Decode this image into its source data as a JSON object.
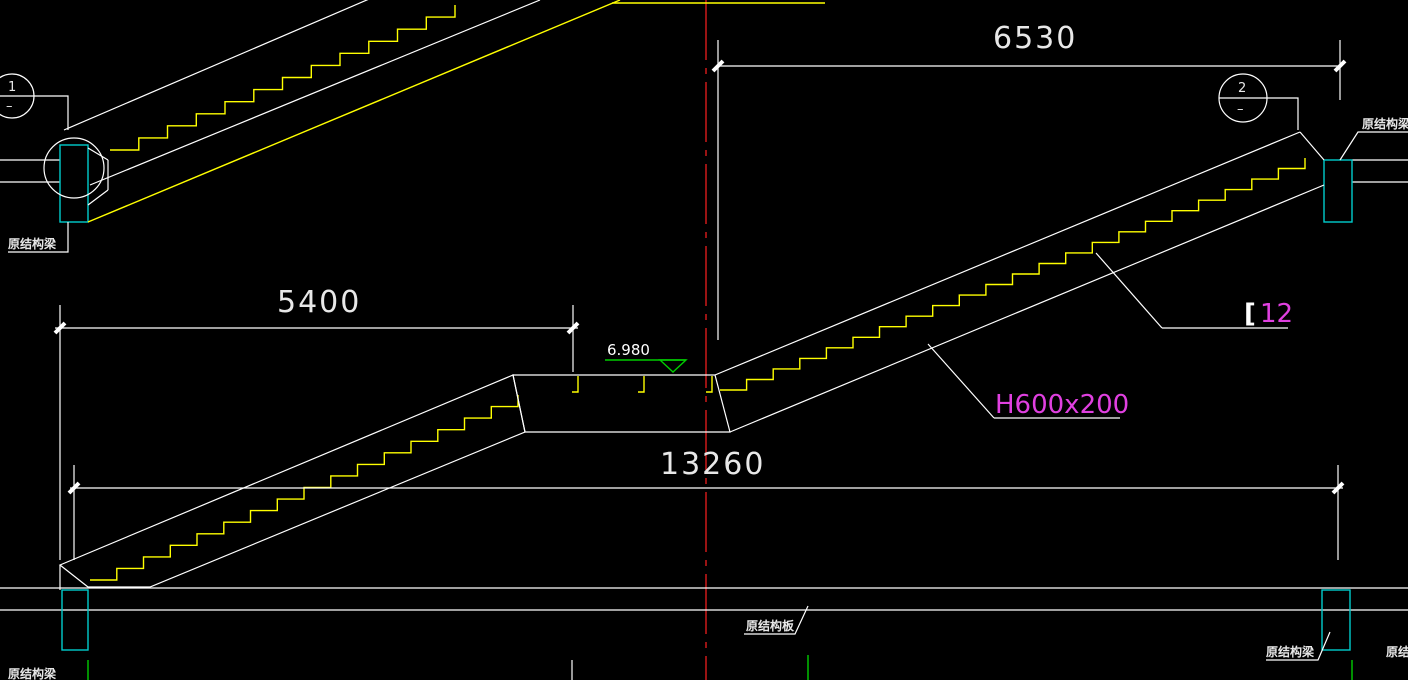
{
  "dimensions": {
    "top_right": "6530",
    "middle_left": "5400",
    "overall": "13260"
  },
  "elevation_mark": "6.980",
  "section_markers": [
    {
      "top": "1",
      "bottom": "–"
    },
    {
      "top": "2",
      "bottom": "–"
    }
  ],
  "member_labels": {
    "beam_h": "H600x200",
    "channel_prefix": "[",
    "channel_num": "12"
  },
  "structure_labels": {
    "orig_beam_top_left": "原结构梁",
    "orig_beam_top_right": "原结构梁",
    "orig_slab": "原结构板",
    "orig_beam_bottom_left": "原结构梁",
    "orig_beam_bottom_right": "原结构梁",
    "orig_beam_far_right": "原结"
  },
  "colors": {
    "background": "#000000",
    "lines": "#ffffff",
    "treads": "#ffff00",
    "columns": "#00cccc",
    "axis": "#ff2020",
    "elevation_triangle": "#00cc00",
    "member_text": "#e040e0"
  }
}
